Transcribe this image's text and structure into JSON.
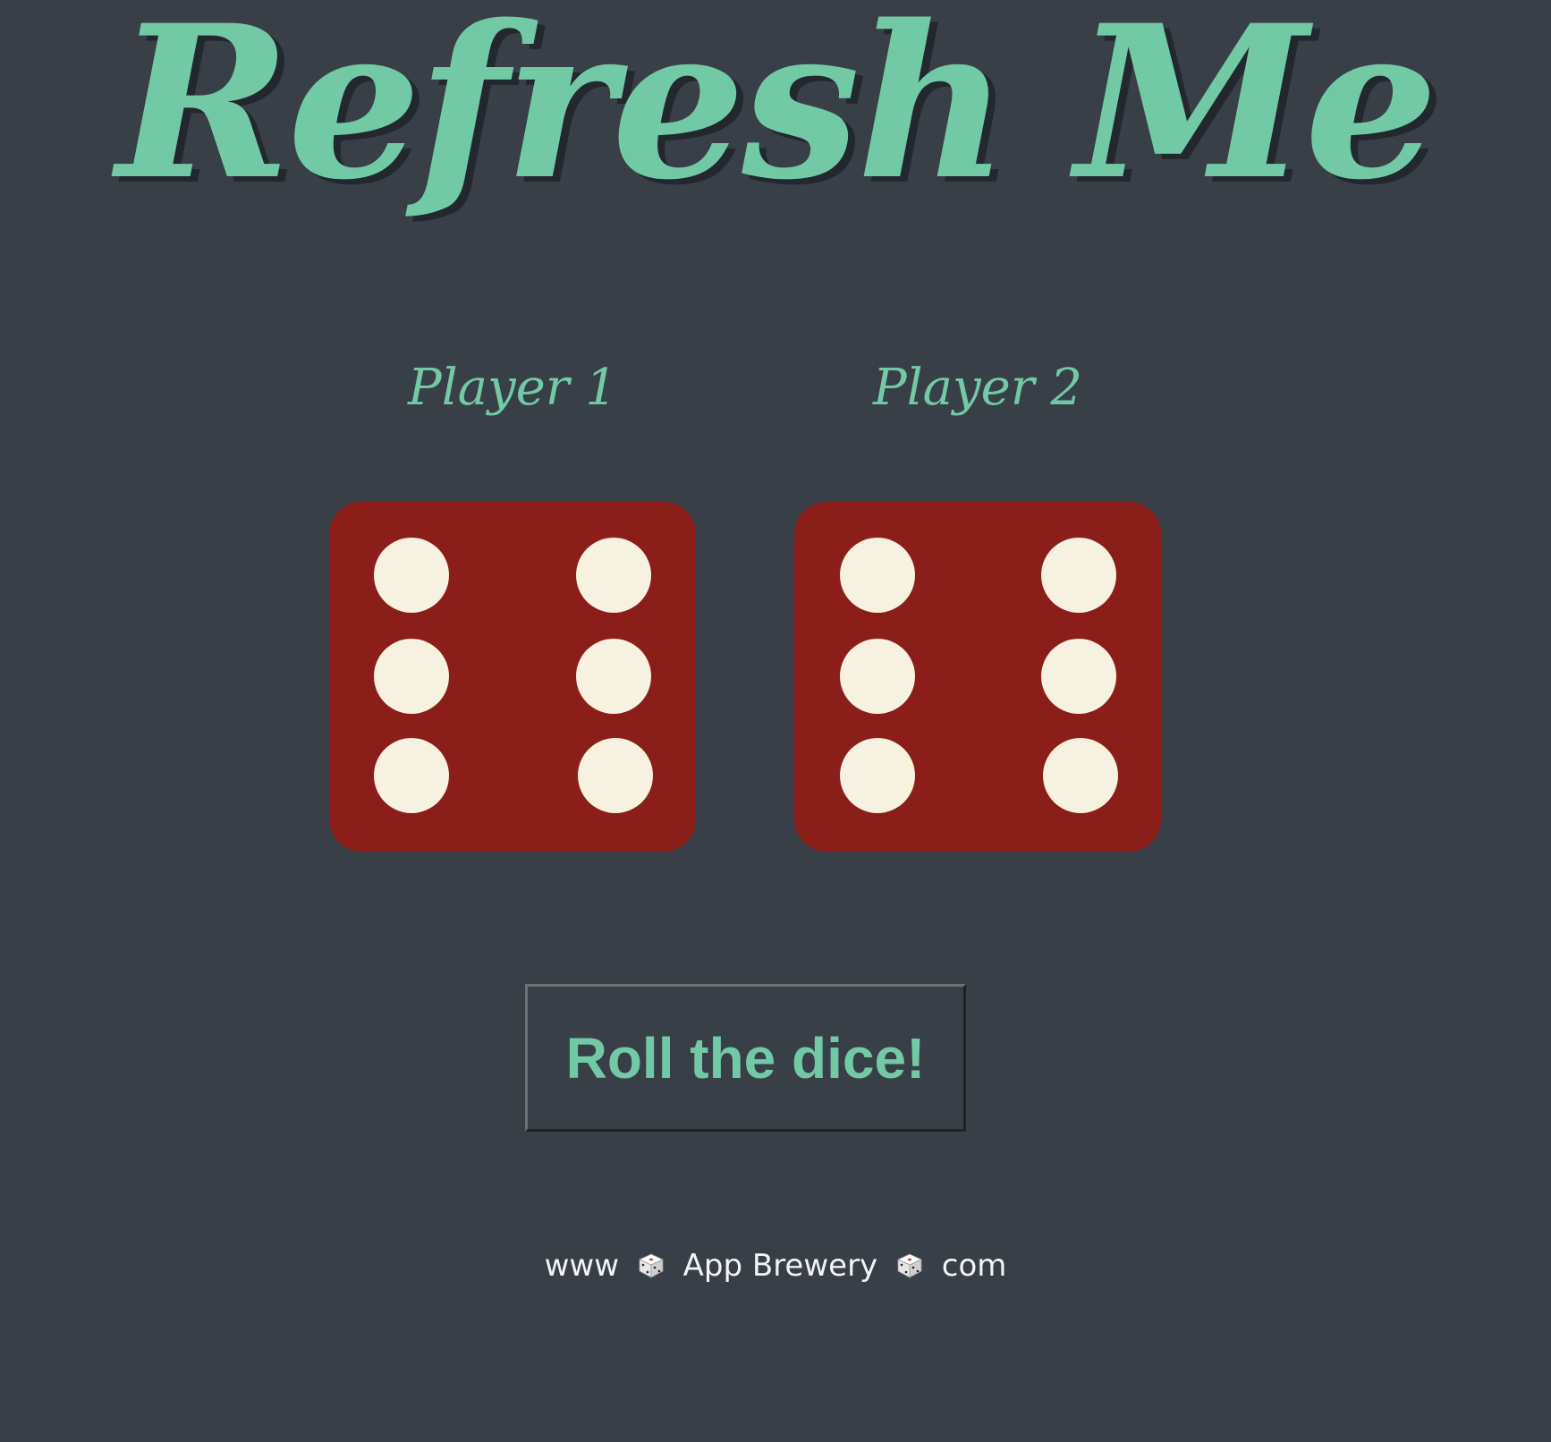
{
  "header": {
    "title": "Refresh Me"
  },
  "players": [
    {
      "label": "Player 1",
      "die_value": 6
    },
    {
      "label": "Player 2",
      "die_value": 6
    }
  ],
  "controls": {
    "roll_button_label": "Roll the dice!"
  },
  "footer": {
    "prefix": "www",
    "brand": "App Brewery",
    "suffix": "com",
    "separator_icon": "dice-icon"
  },
  "colors": {
    "background": "#393f47",
    "accent": "#72c9a6",
    "die_face": "#8c1e1a",
    "pip": "#f7f1df"
  }
}
